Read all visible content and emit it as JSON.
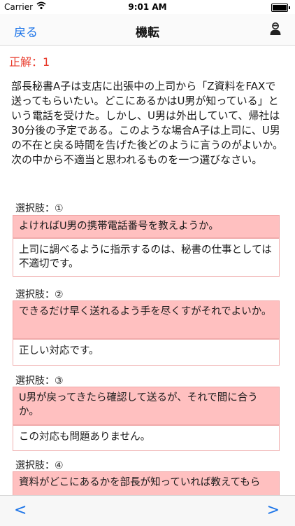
{
  "status_bar": {
    "carrier": "Carrier",
    "time": "9:01 AM"
  },
  "nav": {
    "back_label": "戻る",
    "title": "機転",
    "profile_icon": "person-icon"
  },
  "answer": {
    "text": "正解：1"
  },
  "question": {
    "text": "部長秘書A子は支店に出張中の上司から「Z資料をFAXで送ってもらいたい。どこにあるかはU男が知っている」という電話を受けた。しかし、U男は外出していて、帰社は30分後の予定である。このような場合A子は上司に、U男の不在と戻る時間を告げた後どのように言うのがよいか。次の中から不適当と思われるものを一つ選びなさい。"
  },
  "choices": [
    {
      "label": "選択肢：①",
      "text": "よければU男の携帯電話番号を教えようか。",
      "explanation": "上司に調べるように指示するのは、秘書の仕事としては不適切です。"
    },
    {
      "label": "選択肢：②",
      "text": "できるだけ早く送れるよう手を尽くすがそれでよいか。",
      "explanation": "正しい対応です。"
    },
    {
      "label": "選択肢：③",
      "text": "U男が戻ってきたら確認して送るが、それで間に合うか。",
      "explanation": "この対応も問題ありません。"
    },
    {
      "label": "選択肢：④",
      "text": "資料がどこにあるかを部長が知っていれば教えてもら"
    }
  ],
  "toolbar": {
    "prev_label": "<",
    "next_label": ">"
  },
  "colors": {
    "accent": "#1a73e8",
    "answer": "#e8392a",
    "choice_bg": "#ffc0c0"
  }
}
